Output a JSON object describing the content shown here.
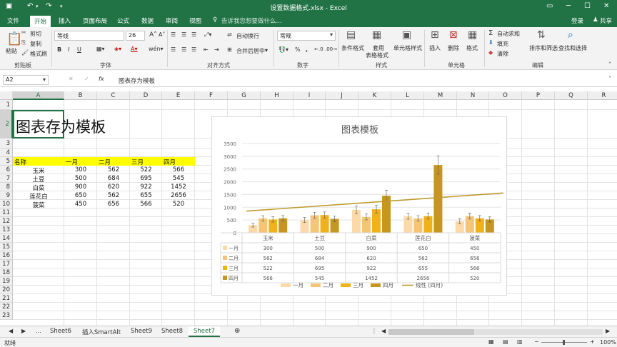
{
  "window": {
    "title": "设置数据格式.xlsx - Excel",
    "signin": "登录",
    "share": "共享"
  },
  "tabs": [
    "文件",
    "开始",
    "插入",
    "页面布局",
    "公式",
    "数据",
    "审阅",
    "视图"
  ],
  "tell_me": "告诉我您想要做什么...",
  "ribbon": {
    "clipboard": {
      "paste": "粘贴",
      "cut": "剪切",
      "copy": "复制",
      "painter": "格式刷",
      "label": "剪贴板"
    },
    "font": {
      "name": "等线",
      "size": "26",
      "label": "字体"
    },
    "alignment": {
      "wrap": "自动换行",
      "merge": "合并后居中",
      "label": "对齐方式"
    },
    "number": {
      "format": "常规",
      "label": "数字"
    },
    "styles": {
      "cond": "条件格式",
      "table1": "套用",
      "table2": "表格格式",
      "cell": "单元格样式",
      "label": "样式"
    },
    "cells": {
      "insert": "插入",
      "delete": "删除",
      "format": "格式",
      "label": "单元格"
    },
    "editing": {
      "autosum": "自动求和",
      "fill": "填充",
      "clear": "清除",
      "sort": "排序和筛选",
      "find": "查找和选择",
      "label": "编辑"
    }
  },
  "namebox": "A2",
  "formula": "图表存为模板",
  "columns": [
    "A",
    "B",
    "C",
    "D",
    "E",
    "F",
    "G",
    "H",
    "I",
    "J",
    "K",
    "L",
    "M",
    "N",
    "O",
    "P",
    "Q",
    "R"
  ],
  "rows": [
    "1",
    "2",
    "3",
    "4",
    "5",
    "6",
    "7",
    "8",
    "9",
    "10",
    "11",
    "12",
    "13",
    "14",
    "15",
    "16",
    "17",
    "18",
    "19",
    "20",
    "21",
    "22",
    "23"
  ],
  "cells": {
    "a2": "图表存为模板",
    "header": [
      "名称",
      "一月",
      "二月",
      "三月",
      "四月"
    ],
    "data": [
      [
        "玉米",
        "300",
        "562",
        "522",
        "566"
      ],
      [
        "土豆",
        "500",
        "684",
        "695",
        "545"
      ],
      [
        "白菜",
        "900",
        "620",
        "922",
        "1452"
      ],
      [
        "莲花白",
        "650",
        "562",
        "655",
        "2656"
      ],
      [
        "菠菜",
        "450",
        "656",
        "566",
        "520"
      ]
    ]
  },
  "chart_data": {
    "type": "bar",
    "title": "图表模板",
    "categories": [
      "玉米",
      "土豆",
      "白菜",
      "莲花白",
      "菠菜"
    ],
    "series": [
      {
        "name": "一月",
        "values": [
          300,
          500,
          900,
          650,
          450
        ],
        "color": "#fbd9a8"
      },
      {
        "name": "二月",
        "values": [
          562,
          684,
          620,
          562,
          656
        ],
        "color": "#f5c476"
      },
      {
        "name": "三月",
        "values": [
          522,
          695,
          922,
          655,
          566
        ],
        "color": "#f0b21b"
      },
      {
        "name": "四月",
        "values": [
          566,
          545,
          1452,
          2656,
          520
        ],
        "color": "#c6961f"
      }
    ],
    "trendline": {
      "name": "线性 (四月)",
      "color": "#c09a2e",
      "start": 850,
      "end": 1560
    },
    "ylim": [
      0,
      3500
    ],
    "yticks": [
      "0",
      "500",
      "1000",
      "1500",
      "2000",
      "2500",
      "3000",
      "3500"
    ],
    "grid": true,
    "data_table": true,
    "legend": "bottom"
  },
  "sheets": [
    "Sheet6",
    "插入SmartAlt",
    "Sheet9",
    "Sheet8",
    "Sheet7"
  ],
  "active_sheet": "Sheet7",
  "status": {
    "ready": "就绪",
    "zoom": "100%"
  }
}
